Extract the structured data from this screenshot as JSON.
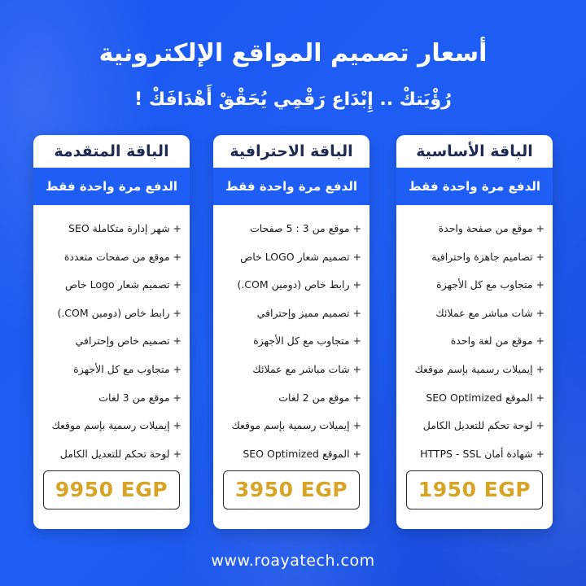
{
  "header": {
    "title": "أسعار تصميم  المواقع الإلكترونية",
    "subtitle": "رُؤْيَتكْ .. إِبْدَاع رَقْمِي يُحَقْقْ أَهْدَافَكْ !"
  },
  "packages": [
    {
      "name": "الباقة الأساسية",
      "payment": "الدفع مرة واحدة فقط",
      "features": [
        "+ موقع من صفحة واحدة",
        "+ تصاميم جاهزة واحترافية",
        "+ متجاوب مع كل الأجهزة",
        "+ شات مباشر مع عملائك",
        "+ موقع من لغة واحدة",
        "+ إيميلات رسمية بإسم موقعك",
        "+ الموقع SEO Optimized",
        "+ لوحة تحكم للتعديل الكامل",
        "+ شهادة أمان HTTPS - SSL"
      ],
      "price": "1950 EGP"
    },
    {
      "name": "الباقة الاحترافية",
      "payment": "الدفع مرة واحدة فقط",
      "features": [
        "+ موقع من 3 : 5 صفحات",
        "+ تصميم شعار LOGO خاص",
        "+ رابط خاص (دومين COM.)",
        "+ تصميم مميز وإحترافي",
        "+ متجاوب مع كل الأجهزة",
        "+ شات مباشر مع عملائك",
        "+ موقع من 2 لغات",
        "+ إيميلات رسمية بإسم موقعك",
        "+ الموقع SEO Optimized"
      ],
      "price": "3950 EGP"
    },
    {
      "name": "الباقة المتقدمة",
      "payment": "الدفع مرة واحدة فقط",
      "features": [
        "+ شهر إدارة متكاملة SEO",
        "+ موقع من صفحات متعددة",
        "+ تصميم شعار Logo خاص",
        "+ رابط خاص (دومين COM.)",
        "+ تصميم خاص وإحترافي",
        "+ متجاوب مع كل الأجهزة",
        "+ موقع من 3 لغات",
        "+ إيميلات رسمية بإسم موقعك",
        "+ لوحة تحكم للتعديل الكامل"
      ],
      "price": "9950 EGP"
    }
  ],
  "footer": {
    "website": "www.roayatech.com"
  }
}
